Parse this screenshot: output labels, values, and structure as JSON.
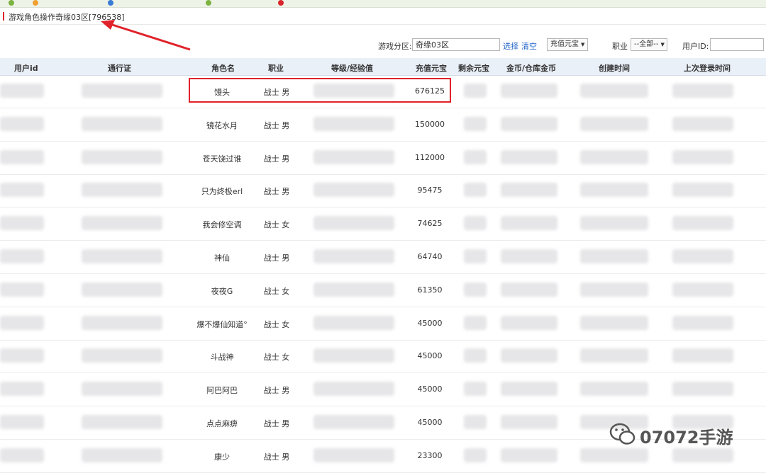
{
  "breadcrumb": {
    "section": "游戏角色操作",
    "server_id": "奇缘03区[796538]"
  },
  "filters": {
    "server_label": "游戏分区:",
    "server_value": "奇缘03区",
    "choose_link": "选择",
    "clear_link": "清空",
    "sort_select": "充值元宝",
    "job_label": "职业",
    "job_select": "--全部--",
    "userid_label": "用户ID:",
    "userid_value": ""
  },
  "table": {
    "columns": [
      "用户id",
      "通行证",
      "角色名",
      "职业",
      "等级/经验值",
      "充值元宝",
      "剩余元宝",
      "金币/仓库金币",
      "创建时间",
      "上次登录时间"
    ],
    "rows": [
      {
        "name": "馒头",
        "job": "战士 男",
        "recharge": "676125"
      },
      {
        "name": "镜花水月",
        "job": "战士 男",
        "recharge": "150000"
      },
      {
        "name": "苍天饶过谁",
        "job": "战士 男",
        "recharge": "112000"
      },
      {
        "name": "只为终极erl",
        "job": "战士 男",
        "recharge": "95475"
      },
      {
        "name": "我会修空调",
        "job": "战士 女",
        "recharge": "74625"
      },
      {
        "name": "神仙",
        "job": "战士 男",
        "recharge": "64740"
      },
      {
        "name": "夜夜G",
        "job": "战士 女",
        "recharge": "61350"
      },
      {
        "name": "爆不爆仙知道°",
        "job": "战士 女",
        "recharge": "45000"
      },
      {
        "name": "斗战神",
        "job": "战士 女",
        "recharge": "45000"
      },
      {
        "name": "阿巴阿巴",
        "job": "战士 男",
        "recharge": "45000"
      },
      {
        "name": "点点麻痹",
        "job": "战士 男",
        "recharge": "45000"
      },
      {
        "name": "康少",
        "job": "战士 男",
        "recharge": "23300"
      }
    ]
  },
  "watermark": {
    "text": "07072手游",
    "icon": "wechat-icon"
  },
  "colors": {
    "highlight": "#e0222a",
    "header_bg": "#eaf0f8",
    "link": "#2367c9"
  }
}
